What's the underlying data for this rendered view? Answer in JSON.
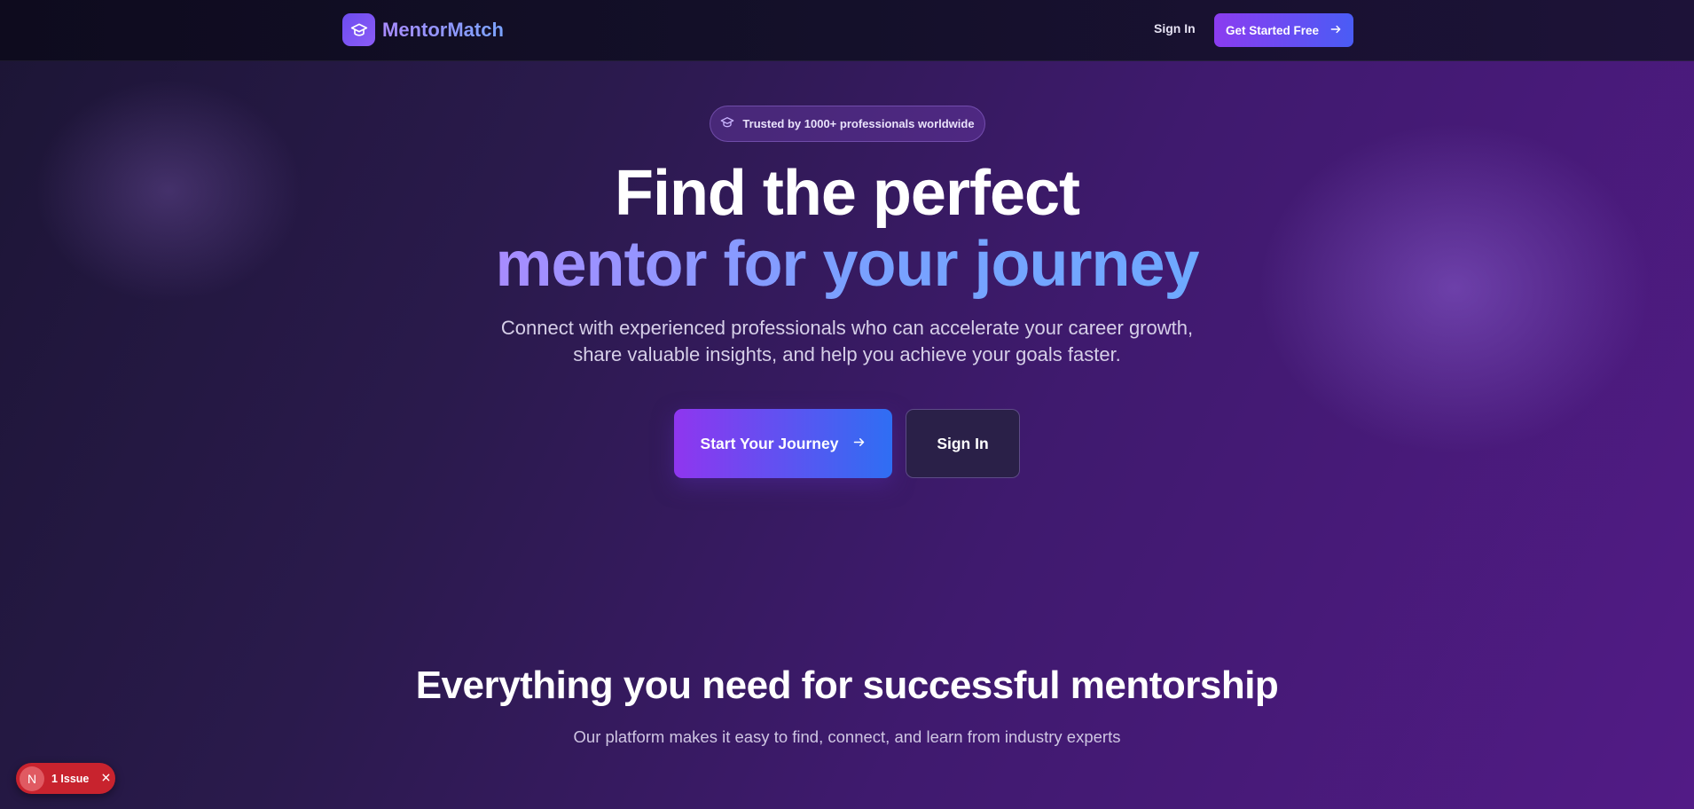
{
  "nav": {
    "brand_name": "MentorMatch",
    "logo_icon": "graduation-cap-icon",
    "signin_label": "Sign In",
    "cta_label": "Get Started Free",
    "cta_icon": "arrow-right-icon"
  },
  "hero": {
    "badge_icon": "graduation-cap-icon",
    "badge_text": "Trusted by 1000+ professionals worldwide",
    "headline_line1": "Find the perfect",
    "headline_line2": "mentor for your journey",
    "subtext": "Connect with experienced professionals who can accelerate your career growth, share valuable insights, and help you achieve your goals faster.",
    "primary_button": "Start Your Journey",
    "primary_icon": "arrow-right-icon",
    "secondary_button": "Sign In"
  },
  "features": {
    "title": "Everything you need for successful mentorship",
    "subtitle": "Our platform makes it easy to find, connect, and learn from industry experts"
  },
  "dev_overlay": {
    "avatar_letter": "N",
    "issue_label": "1 Issue",
    "close_icon": "close-icon"
  },
  "colors": {
    "accent_purple": "#8b3cf0",
    "accent_blue": "#3b6ef5",
    "gradient_text_start": "#a88cff",
    "gradient_text_end": "#6ea9ff",
    "issue_red": "#c8232e"
  }
}
